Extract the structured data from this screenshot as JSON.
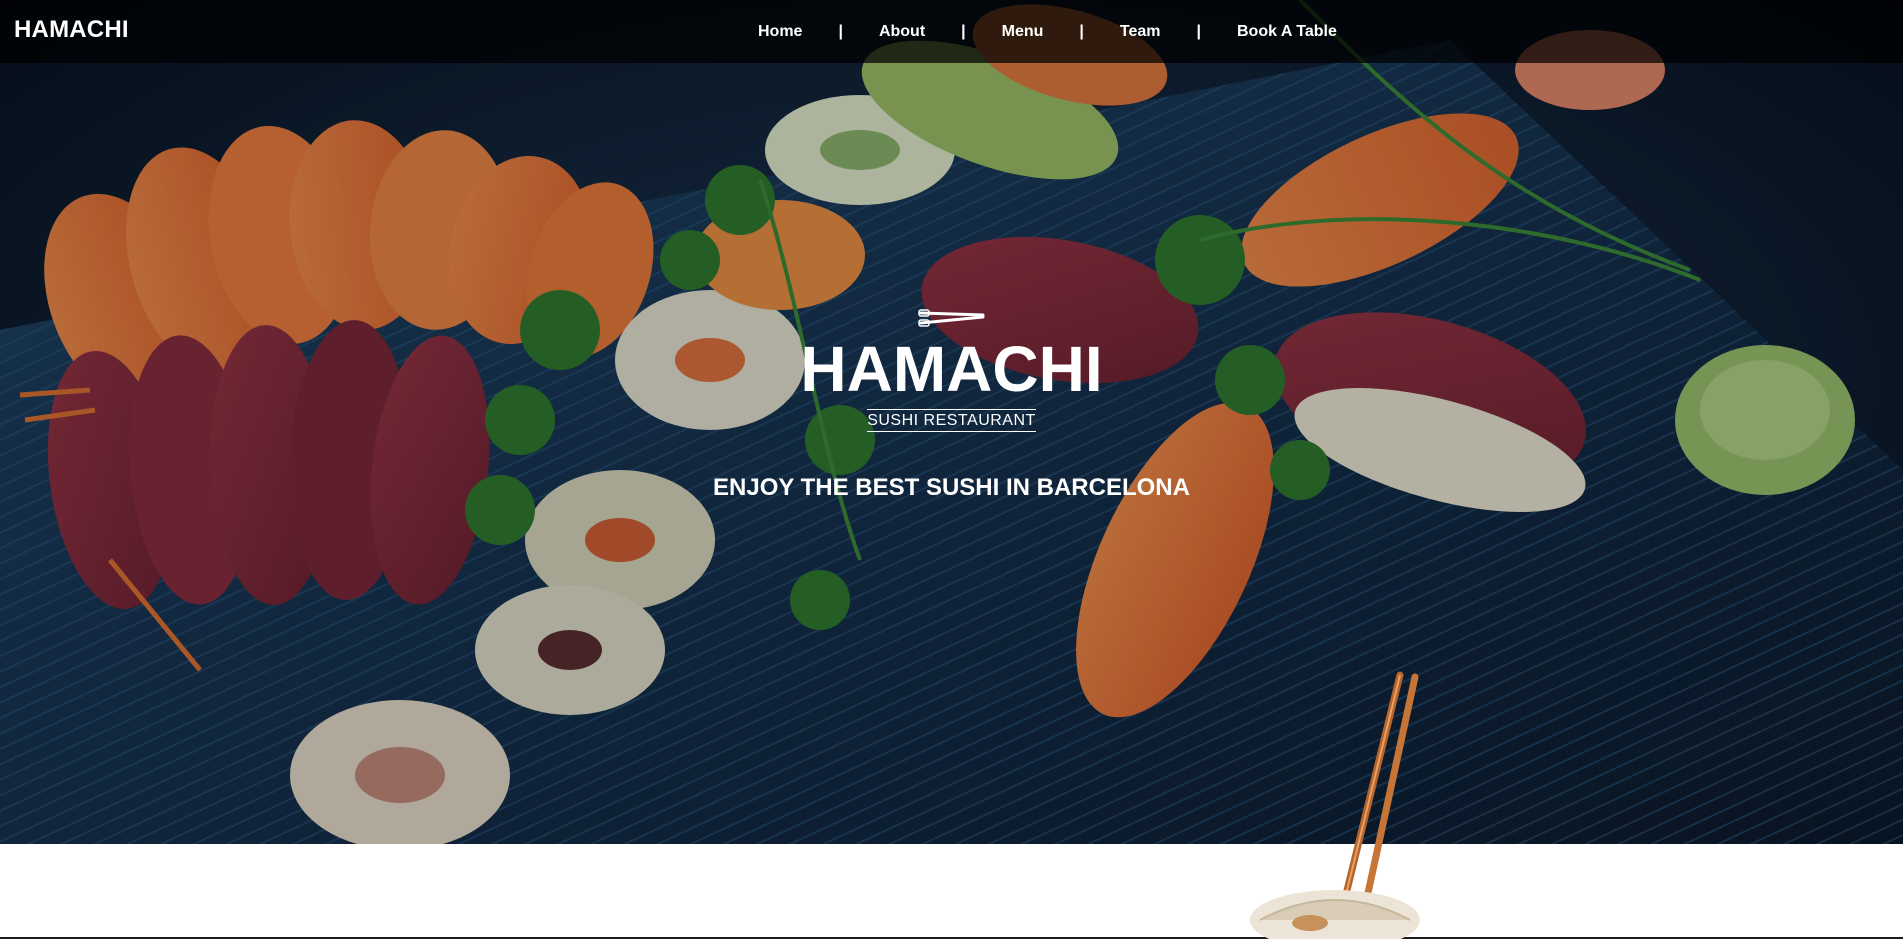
{
  "nav": {
    "brand": "HAMACHI",
    "links": [
      {
        "label": "Home"
      },
      {
        "label": "About"
      },
      {
        "label": "Menu"
      },
      {
        "label": "Team"
      },
      {
        "label": "Book A Table"
      }
    ],
    "separator": "|"
  },
  "hero": {
    "title": "HAMACHI",
    "subtitle": "SUSHI RESTAURANT",
    "tagline": "ENJOY THE BEST SUSHI IN BARCELONA",
    "logo_icon": "chopsticks-icon"
  },
  "colors": {
    "nav_background": "#000000",
    "hero_text": "#ffffff",
    "board": "#15324f",
    "salmon": "#f07a3a",
    "tuna": "#8a2a3a",
    "wasabi": "#9cc36a",
    "parsley": "#2f7a2a",
    "chopstick": "#b5652b"
  }
}
